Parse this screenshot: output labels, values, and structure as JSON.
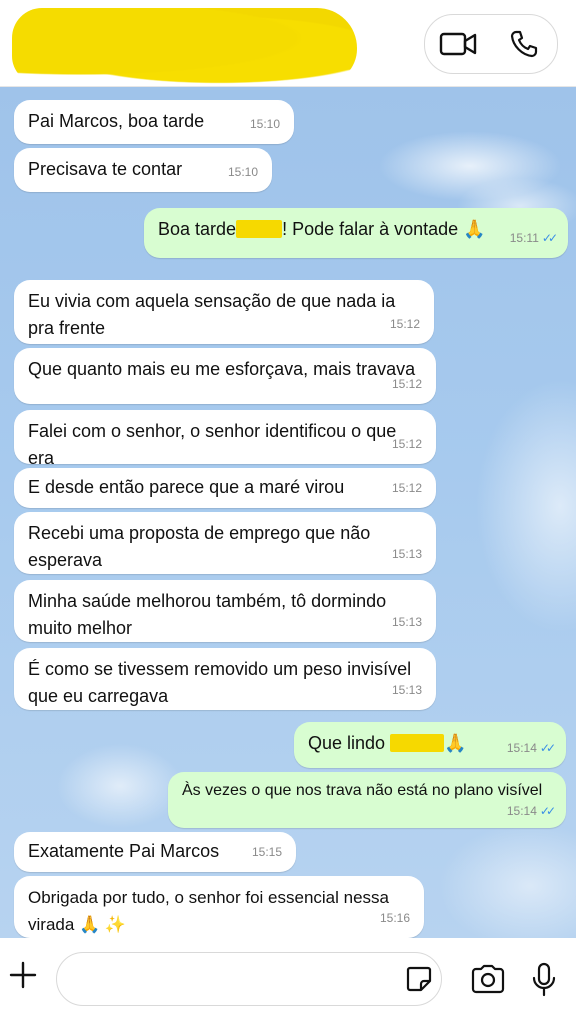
{
  "header": {
    "video_call_icon": "video-camera-icon",
    "voice_call_icon": "phone-icon"
  },
  "messages": [
    {
      "text": "Pai Marcos, boa tarde",
      "time": "15:10"
    },
    {
      "text": "Precisava te contar",
      "time": "15:10"
    },
    {
      "text_before": "Boa tarde",
      "text_after": "! Pode falar à vontade 🙏",
      "time": "15:11"
    },
    {
      "text": "Eu vivia com aquela sensação de que nada ia pra frente",
      "time": "15:12"
    },
    {
      "text": "Que quanto mais eu me esforçava, mais travava",
      "time": "15:12"
    },
    {
      "text": "Falei com o senhor, o senhor identificou o que era",
      "time": "15:12"
    },
    {
      "text": "E desde então parece que a maré virou",
      "time": "15:12"
    },
    {
      "text": "Recebi uma proposta de emprego que não esperava",
      "time": "15:13"
    },
    {
      "text": "Minha saúde melhorou também, tô dormindo muito melhor",
      "time": "15:13"
    },
    {
      "text": "É como se tivessem removido um peso invisível que eu carregava",
      "time": "15:13"
    },
    {
      "text_before": "Que lindo ",
      "text_after": "🙏",
      "time": "15:14"
    },
    {
      "text": "Às vezes o que nos trava não está no plano visível",
      "time": "15:14"
    },
    {
      "text": "Exatamente Pai Marcos",
      "time": "15:15"
    },
    {
      "text": "Obrigada por tudo, o senhor foi essencial nessa virada 🙏 ✨",
      "time": "15:16"
    }
  ],
  "footer": {
    "input_value": "",
    "placeholder": ""
  }
}
